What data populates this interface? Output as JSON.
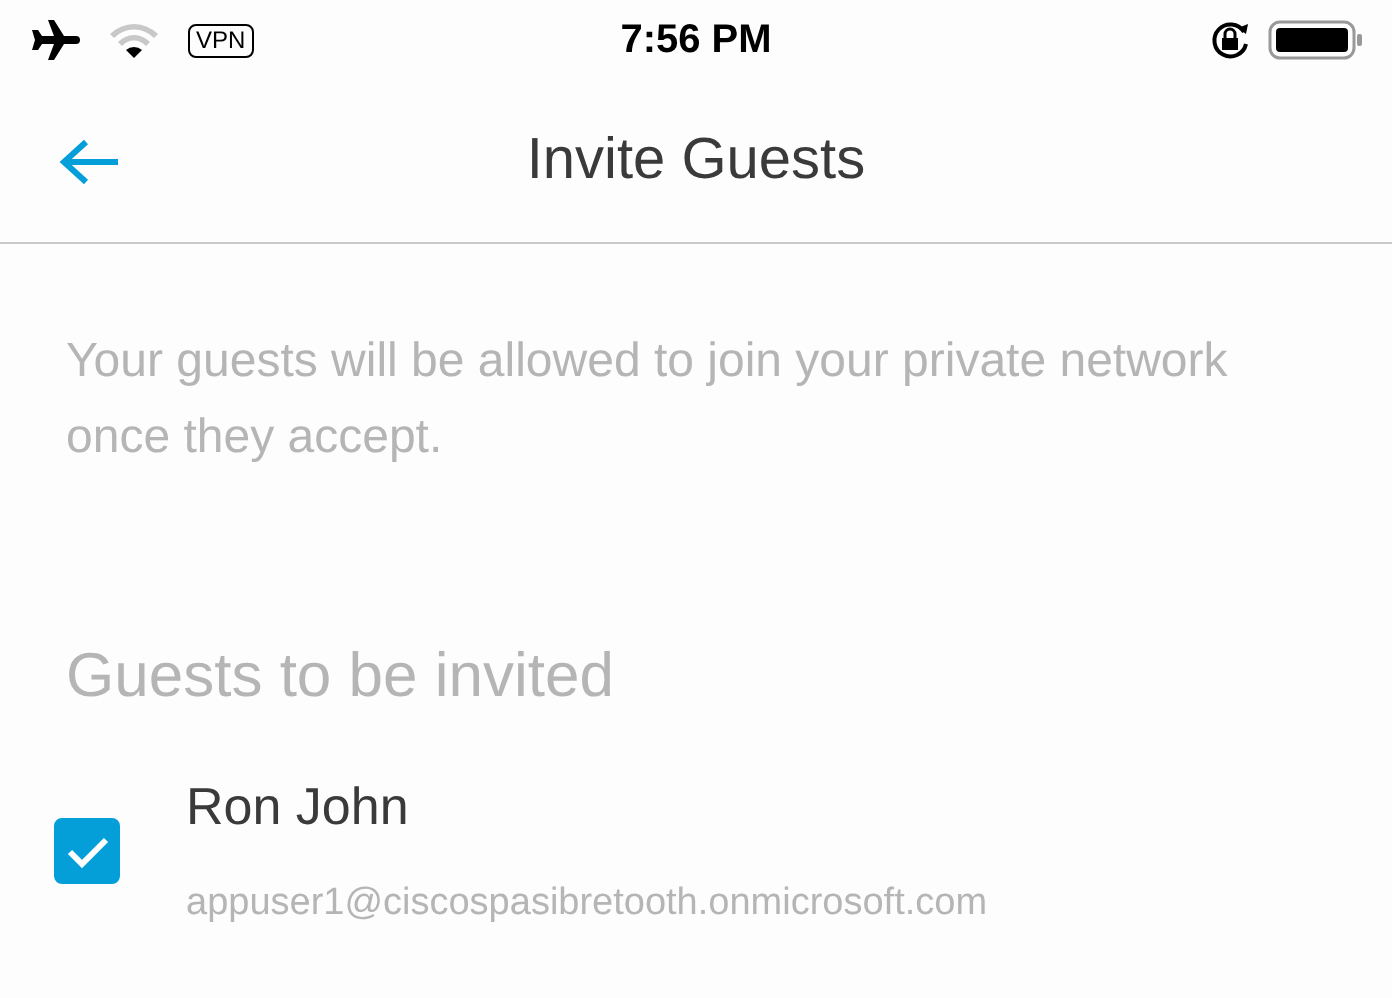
{
  "status_bar": {
    "vpn_label": "VPN",
    "time": "7:56 PM"
  },
  "nav": {
    "title": "Invite Guests"
  },
  "info": "Your guests will be allowed to join your private network once they accept.",
  "section_title": "Guests to be invited",
  "guests": [
    {
      "name": "Ron John",
      "email": "appuser1@ciscospasibretooth.onmicrosoft.com",
      "checked": true
    }
  ]
}
